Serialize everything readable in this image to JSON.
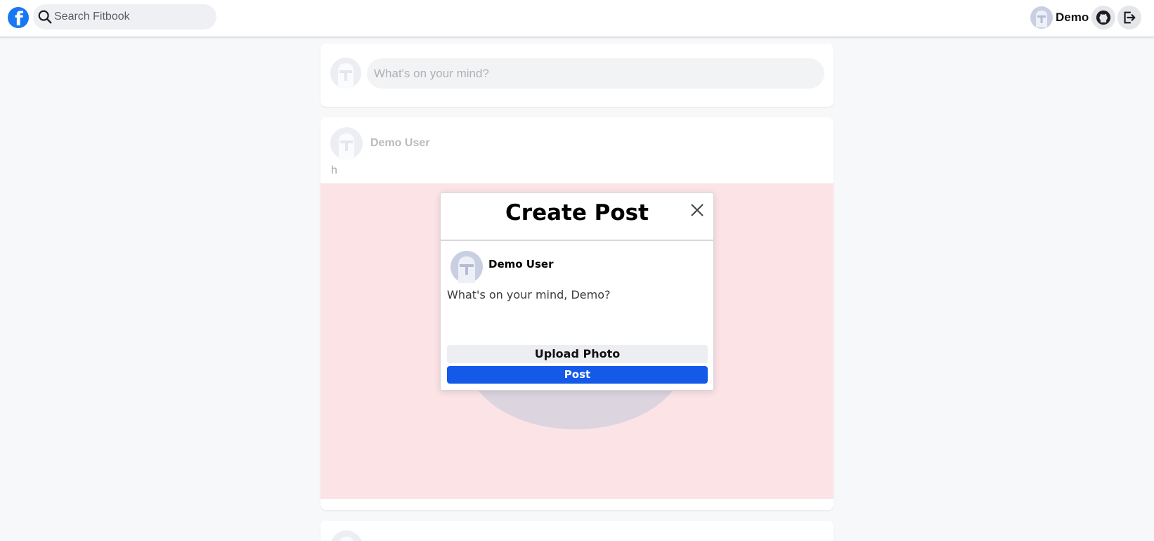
{
  "app": {
    "brand_color": "#1877f2",
    "logo_letter": "f"
  },
  "search": {
    "placeholder": "Search Fitbook",
    "value": ""
  },
  "header": {
    "user_name": "Demo",
    "github_icon": "github-icon",
    "logout_icon": "logout-icon"
  },
  "composer": {
    "placeholder": "What's on your mind?"
  },
  "feed": [
    {
      "author": "Demo User",
      "text": "h",
      "has_image": true
    }
  ],
  "modal": {
    "title": "Create Post",
    "close_icon": "close-icon",
    "author": "Demo User",
    "text_placeholder": "What's on your mind, Demo?",
    "upload_label": "Upload Photo",
    "post_label": "Post",
    "post_button_color": "#1459e8"
  }
}
